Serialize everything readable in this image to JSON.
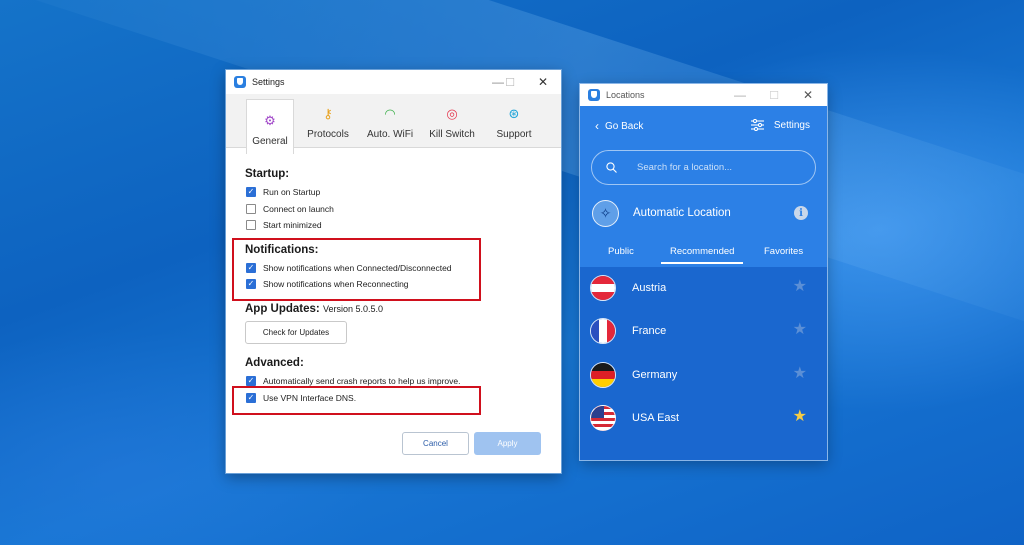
{
  "settings_window": {
    "title": "Settings",
    "controls": {
      "minimize": "—",
      "maximize": "☐",
      "close": "✕"
    },
    "tabs": [
      {
        "label": "General",
        "icon": "gear-icon",
        "glyph": "⚙",
        "color": "#a046c8",
        "active": true
      },
      {
        "label": "Protocols",
        "icon": "key-icon",
        "glyph": "⚷",
        "color": "#e8a11e",
        "active": false
      },
      {
        "label": "Auto. WiFi",
        "icon": "wifi-icon",
        "glyph": "◠",
        "color": "#3db04b",
        "active": false
      },
      {
        "label": "Kill Switch",
        "icon": "kill-switch-icon",
        "glyph": "◎",
        "color": "#e53950",
        "active": false
      },
      {
        "label": "Support",
        "icon": "support-icon",
        "glyph": "⊛",
        "color": "#1ba3d9",
        "active": false
      }
    ],
    "startup": {
      "title": "Startup:",
      "items": [
        {
          "label": "Run on Startup",
          "checked": true
        },
        {
          "label": "Connect on launch",
          "checked": false
        },
        {
          "label": "Start minimized",
          "checked": false
        }
      ]
    },
    "notifications": {
      "title": "Notifications:",
      "items": [
        {
          "label": "Show notifications when Connected/Disconnected",
          "checked": true
        },
        {
          "label": "Show notifications when Reconnecting",
          "checked": true
        }
      ]
    },
    "app_updates": {
      "title": "App Updates:",
      "version": "Version 5.0.5.0",
      "button": "Check for Updates"
    },
    "advanced": {
      "title": "Advanced:",
      "items": [
        {
          "label": "Automatically send crash reports to help us improve.",
          "checked": true
        },
        {
          "label": "Use VPN Interface DNS.",
          "checked": true
        }
      ]
    },
    "buttons": {
      "cancel": "Cancel",
      "apply": "Apply"
    }
  },
  "locations_window": {
    "title": "Locations",
    "controls": {
      "minimize": "—",
      "maximize": "☐",
      "close": "✕"
    },
    "go_back": "Go Back",
    "settings": "Settings",
    "search_placeholder": "Search for a location...",
    "automatic_location": "Automatic Location",
    "tabs": [
      {
        "label": "Public",
        "active": false
      },
      {
        "label": "Recommended",
        "active": true
      },
      {
        "label": "Favorites",
        "active": false
      }
    ],
    "countries": [
      {
        "name": "Austria",
        "favorite": false
      },
      {
        "name": "France",
        "favorite": false
      },
      {
        "name": "Germany",
        "favorite": false
      },
      {
        "name": "USA East",
        "favorite": true
      }
    ]
  },
  "colors": {
    "brand_blue": "#2c80e6",
    "check_blue": "#2b6fd6",
    "highlight_red": "#d0101d",
    "star_gold": "#f5cc45"
  }
}
